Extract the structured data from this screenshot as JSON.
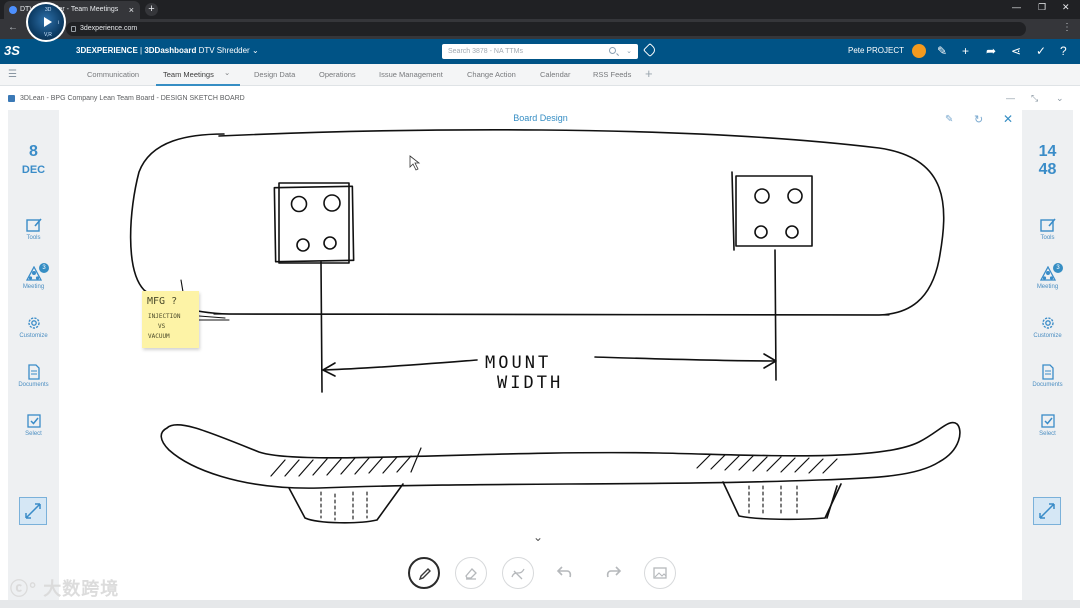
{
  "browser": {
    "tab_title": "DTV Shredder - Team Meetings",
    "tab_close": "×",
    "new_tab": "+",
    "url": "3dexperience.com",
    "controls": {
      "minimize": "—",
      "restore": "❐",
      "close": "✕"
    }
  },
  "topbar": {
    "ds_logo": "3S",
    "brand_prefix": "3DEXPERIENCE",
    "brand_app": "3DDashboard",
    "brand_name": "DTV Shredder",
    "search_placeholder": "Search 3878 - NA TTMs",
    "user_name": "Pete PROJECT",
    "compass_quadrants": [
      "3D",
      "V,R",
      "i"
    ]
  },
  "dashboard_tabs": {
    "items": [
      "Communication",
      "Team Meetings",
      "Design Data",
      "Operations",
      "Issue Management",
      "Change Action",
      "Calendar",
      "RSS Feeds"
    ],
    "active": "Team Meetings",
    "add": "+"
  },
  "widget": {
    "title": "3DLean - BPG Company Lean Team Board - DESIGN SKETCH BOARD"
  },
  "board": {
    "title": "Board Design",
    "sticky_note": {
      "line1": "MFG ?",
      "line2": "INJECTION",
      "line3": "VS",
      "line4": "VACUUM"
    },
    "annotation": {
      "line1": "MOUNT",
      "line2": "WIDTH"
    }
  },
  "left_panel": {
    "day": "8",
    "month": "DEC",
    "tools": [
      {
        "label": "Tools",
        "icon": "edit-note-icon"
      },
      {
        "label": "Meeting",
        "icon": "meeting-people-icon",
        "badge": "3"
      },
      {
        "label": "Customize",
        "icon": "gear-icon"
      },
      {
        "label": "Documents",
        "icon": "document-icon"
      },
      {
        "label": "Select",
        "icon": "checkbox-icon"
      }
    ]
  },
  "right_panel": {
    "hour": "14",
    "minute": "48",
    "tools": [
      {
        "label": "Tools",
        "icon": "edit-note-icon"
      },
      {
        "label": "Meeting",
        "icon": "meeting-people-icon",
        "badge": "3"
      },
      {
        "label": "Customize",
        "icon": "gear-icon"
      },
      {
        "label": "Documents",
        "icon": "document-icon"
      },
      {
        "label": "Select",
        "icon": "checkbox-icon"
      }
    ]
  },
  "bottom_toolbar": {
    "tools": [
      "pen-icon",
      "eraser-icon",
      "clear-icon",
      "undo-icon",
      "redo-icon",
      "image-icon"
    ],
    "active": "pen-icon"
  },
  "watermark": "大数跨境",
  "colors": {
    "topbar": "#005386",
    "accent": "#368ec4",
    "sticky": "#fdf3a6"
  }
}
